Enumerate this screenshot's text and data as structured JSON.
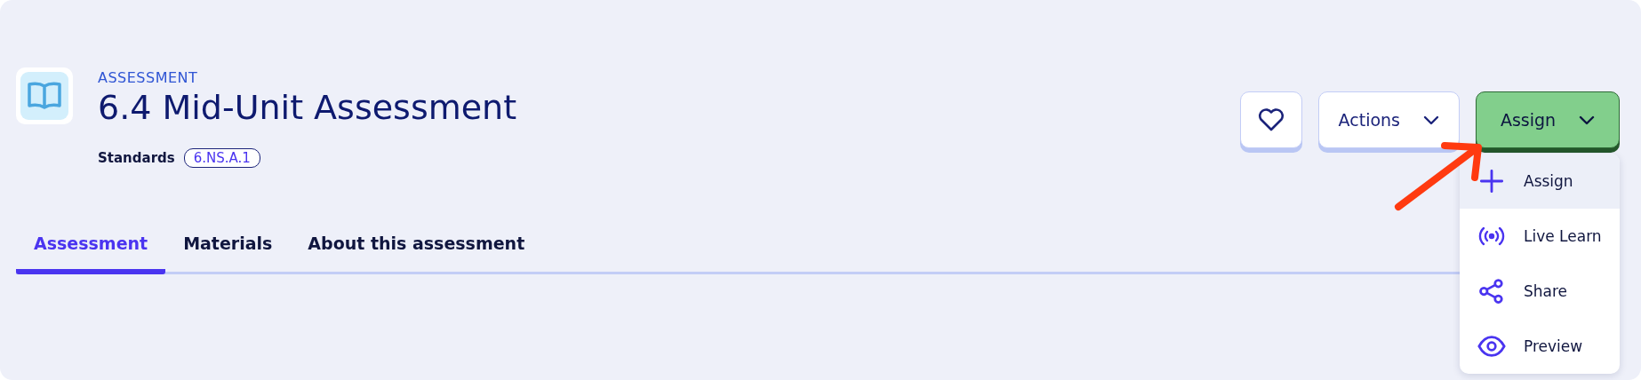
{
  "header": {
    "eyebrow": "ASSESSMENT",
    "title": "6.4 Mid-Unit Assessment",
    "standards_label": "Standards",
    "standards": [
      "6.NS.A.1"
    ]
  },
  "actions": {
    "actions_button": {
      "label": "Actions"
    },
    "assign_button": {
      "label": "Assign",
      "expanded": true
    }
  },
  "assign_menu": [
    {
      "kind": "plus",
      "label": "Assign",
      "selected": true
    },
    {
      "kind": "broadcast",
      "label": "Live Learn",
      "selected": false
    },
    {
      "kind": "share",
      "label": "Share",
      "selected": false
    },
    {
      "kind": "eye",
      "label": "Preview",
      "selected": false
    }
  ],
  "tabs": [
    {
      "label": "Assessment",
      "selected": true
    },
    {
      "label": "Materials",
      "selected": false
    },
    {
      "label": "About this assessment",
      "selected": false
    }
  ]
}
